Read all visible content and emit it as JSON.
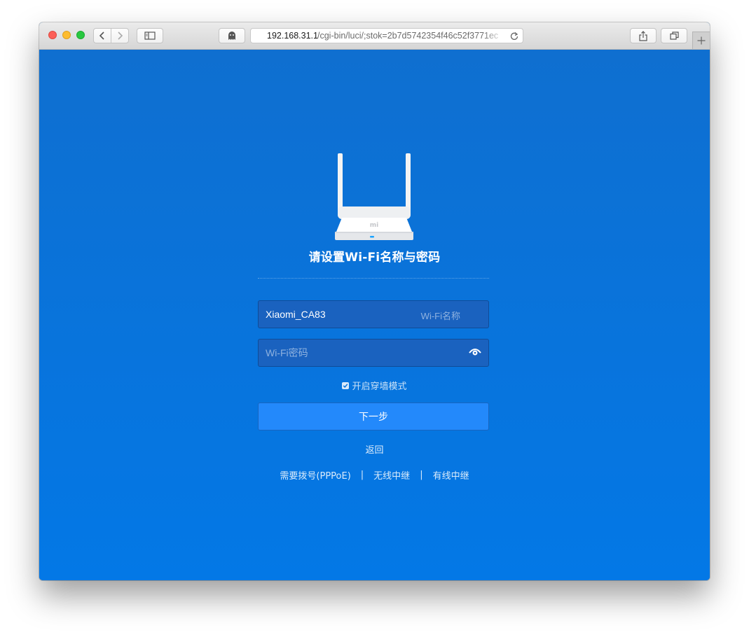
{
  "browser": {
    "url_host": "192.168.31.1",
    "url_path": "/cgi-bin/luci/;stok=2b7d5742354f46c52f3771ec"
  },
  "page": {
    "title": "请设置Wi-Fi名称与密码",
    "ssid": {
      "value": "Xiaomi_CA83",
      "hint": "Wi-Fi名称"
    },
    "password": {
      "value": "",
      "placeholder": "Wi-Fi密码"
    },
    "wall_mode": {
      "label": "开启穿墙模式",
      "checked": true
    },
    "next_label": "下一步",
    "back_label": "返回",
    "modes": {
      "pppoe": "需要拨号(PPPoE)",
      "wireless_relay": "无线中继",
      "wired_relay": "有线中继",
      "separator": "|"
    },
    "router_logo": "mi"
  },
  "colors": {
    "background": "#0a74dc",
    "button": "#2389fb",
    "field": "#1a62bf"
  },
  "icons": {
    "privacy": "ghost-icon",
    "reload": "reload-icon",
    "share": "share-icon",
    "tabs": "tabs-icon",
    "sidebar": "sidebar-icon",
    "password_visibility": "eye-icon"
  }
}
